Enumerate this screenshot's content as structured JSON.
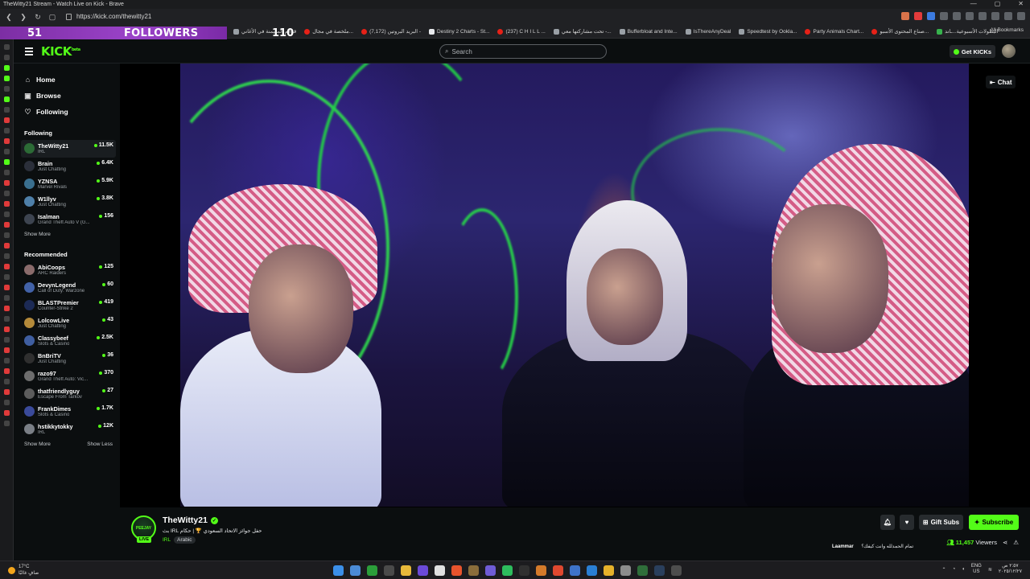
{
  "browser": {
    "window_title": "TheWitty21 Stream - Watch Live on Kick - Brave",
    "url": "https://kick.com/thewitty21",
    "bookmarks": [
      {
        "label": "قوائم المهيمنة في الأغاني",
        "icon": "page-icon"
      },
      {
        "label": "ملخصة في مجال...",
        "icon": "youtube-icon"
      },
      {
        "label": "البريد البروتين (7,172) -",
        "icon": "youtube-icon"
      },
      {
        "label": "Destiny 2 Charts - St...",
        "icon": "page-icon"
      },
      {
        "label": "(237) C H I L L ...",
        "icon": "youtube-icon"
      },
      {
        "label": "تحت مشاركتها معي -...",
        "icon": "drive-icon"
      },
      {
        "label": "Bufferbloat and Inte...",
        "icon": "waveform-icon"
      },
      {
        "label": "IsThereAnyDeal",
        "icon": "tag-icon"
      },
      {
        "label": "Speedtest by Ookla...",
        "icon": "speedtest-icon"
      },
      {
        "label": "Party Animals Chart...",
        "icon": "page-icon"
      },
      {
        "label": "صناع المحتوى الأسبو...",
        "icon": "youtube-icon"
      },
      {
        "label": "البطولات الأسبوعية...ـاند",
        "icon": "green-icon"
      }
    ],
    "all_bookmarks": "All Bookmarks"
  },
  "overlay": {
    "follower_count": "51",
    "followers_label": "FOLLOWERS",
    "goal": "110"
  },
  "kick": {
    "logo": "KICK",
    "logo_badge": "beta",
    "search_placeholder": "Search",
    "get_kicks": "Get KICKs",
    "nav": [
      {
        "label": "Home",
        "icon": "home-icon",
        "glyph": "⌂"
      },
      {
        "label": "Browse",
        "icon": "browse-icon",
        "glyph": "▣"
      },
      {
        "label": "Following",
        "icon": "heart-icon",
        "glyph": "♡"
      }
    ],
    "following_title": "Following",
    "following": [
      {
        "name": "TheWitty21",
        "category": "IRL",
        "viewers": "11.5K",
        "avatar_color": "#2c6b36"
      },
      {
        "name": "Brain",
        "category": "Just Chatting",
        "viewers": "6.4K",
        "avatar_color": "#2b2f3a"
      },
      {
        "name": "YZNSA",
        "category": "Marvel Rivals",
        "viewers": "5.9K",
        "avatar_color": "#3a6f8e"
      },
      {
        "name": "W1llyv",
        "category": "Just Chatting",
        "viewers": "3.8K",
        "avatar_color": "#4e7fa8"
      },
      {
        "name": "Isalman",
        "category": "Grand Theft Auto V (G...",
        "viewers": "156",
        "avatar_color": "#3d4450"
      }
    ],
    "show_more": "Show More",
    "show_less": "Show Less",
    "recommended_title": "Recommended",
    "recommended": [
      {
        "name": "AbiCoops",
        "category": "ARC Raiders",
        "viewers": "125",
        "avatar_color": "#8a6b6b"
      },
      {
        "name": "DevynLegend",
        "category": "Call of Duty: Warzone",
        "viewers": "60",
        "avatar_color": "#4262a8"
      },
      {
        "name": "BLASTPremier",
        "category": "Counter-Strike 2",
        "viewers": "419",
        "avatar_color": "#1c2a55"
      },
      {
        "name": "LolcowLive",
        "category": "Just Chatting",
        "viewers": "43",
        "avatar_color": "#b48a3a"
      },
      {
        "name": "Classybeef",
        "category": "Slots & Casino",
        "viewers": "2.5K",
        "avatar_color": "#3f5ea0"
      },
      {
        "name": "BnBriTV",
        "category": "Just Chatting",
        "viewers": "36",
        "avatar_color": "#2f2f2f"
      },
      {
        "name": "razo97",
        "category": "Grand Theft Auto: Vic...",
        "viewers": "370",
        "avatar_color": "#6d6d6d"
      },
      {
        "name": "thatfriendlyguy",
        "category": "Escape From Tarkov",
        "viewers": "27",
        "avatar_color": "#5c5c5c"
      },
      {
        "name": "FrankDimes",
        "category": "Slots & Casino",
        "viewers": "1.7K",
        "avatar_color": "#3a4a9a"
      },
      {
        "name": "hstikkytokky",
        "category": "IRL",
        "viewers": "12K",
        "avatar_color": "#7a7f86"
      }
    ],
    "chat_button": "Chat"
  },
  "stream": {
    "channel": "TheWitty21",
    "avatar_text": "PEEJAY",
    "live_badge": "LIVE",
    "title": "حفل جوائز الاتحاد السعودي 🏆 | حكام IRL بث",
    "category": "IRL",
    "language": "Arabic",
    "gift_subs": "Gift Subs",
    "subscribe": "Subscribe",
    "viewers": "11,457",
    "viewers_label": "Viewers",
    "chat_user": "Laammar",
    "chat_message": "تمام الحمدلله وانت كيفك؟"
  },
  "taskbar": {
    "temperature": "17°C",
    "weather": "صافٍ غالبًا",
    "lang_top": "ENG",
    "lang_bottom": "US",
    "time": "٢:٥٧ ص",
    "date": "٢٠٢٥/١٢/٢٧"
  },
  "colors": {
    "kick_green": "#53fc18",
    "overlay_purple": "#9b43c9",
    "background": "#0b0e0f"
  }
}
